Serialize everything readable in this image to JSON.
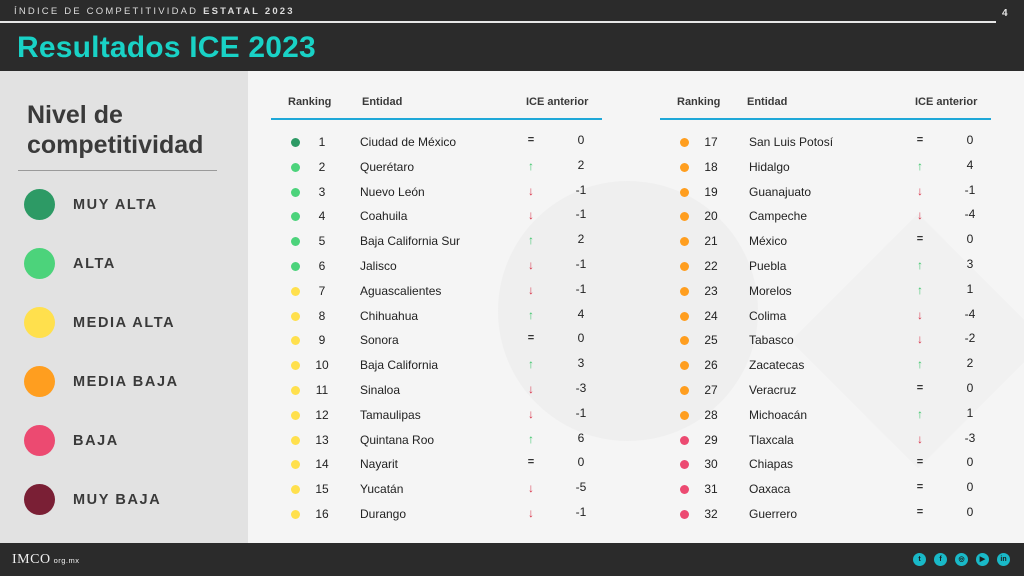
{
  "header": {
    "overline_light": "ÍNDICE DE COMPETITIVIDAD ",
    "overline_bold": "ESTATAL 2023",
    "page_number": "4",
    "title": "Resultados ICE 2023"
  },
  "legend": {
    "title": "Nivel de competitividad",
    "items": [
      {
        "label": "MUY ALTA",
        "color": "#2d9a65"
      },
      {
        "label": "ALTA",
        "color": "#4cd37b"
      },
      {
        "label": "MEDIA ALTA",
        "color": "#ffe04d"
      },
      {
        "label": "MEDIA BAJA",
        "color": "#ff9e1f"
      },
      {
        "label": "BAJA",
        "color": "#ec4a71"
      },
      {
        "label": "MUY BAJA",
        "color": "#7a1f35"
      }
    ]
  },
  "table": {
    "columns": [
      "Ranking",
      "Entidad",
      "ICE anterior"
    ],
    "left_rows": [
      {
        "rank": "1",
        "entity": "Ciudad de México",
        "trend": "=",
        "change": "0",
        "color": "#2d9a65"
      },
      {
        "rank": "2",
        "entity": "Querétaro",
        "trend": "↑",
        "change": "2",
        "color": "#4cd37b"
      },
      {
        "rank": "3",
        "entity": "Nuevo León",
        "trend": "↓",
        "change": "-1",
        "color": "#4cd37b"
      },
      {
        "rank": "4",
        "entity": "Coahuila",
        "trend": "↓",
        "change": "-1",
        "color": "#4cd37b"
      },
      {
        "rank": "5",
        "entity": "Baja California Sur",
        "trend": "↑",
        "change": "2",
        "color": "#4cd37b"
      },
      {
        "rank": "6",
        "entity": "Jalisco",
        "trend": "↓",
        "change": "-1",
        "color": "#4cd37b"
      },
      {
        "rank": "7",
        "entity": "Aguascalientes",
        "trend": "↓",
        "change": "-1",
        "color": "#ffe04d"
      },
      {
        "rank": "8",
        "entity": "Chihuahua",
        "trend": "↑",
        "change": "4",
        "color": "#ffe04d"
      },
      {
        "rank": "9",
        "entity": "Sonora",
        "trend": "=",
        "change": "0",
        "color": "#ffe04d"
      },
      {
        "rank": "10",
        "entity": "Baja California",
        "trend": "↑",
        "change": "3",
        "color": "#ffe04d"
      },
      {
        "rank": "11",
        "entity": "Sinaloa",
        "trend": "↓",
        "change": "-3",
        "color": "#ffe04d"
      },
      {
        "rank": "12",
        "entity": "Tamaulipas",
        "trend": "↓",
        "change": "-1",
        "color": "#ffe04d"
      },
      {
        "rank": "13",
        "entity": "Quintana Roo",
        "trend": "↑",
        "change": "6",
        "color": "#ffe04d"
      },
      {
        "rank": "14",
        "entity": "Nayarit",
        "trend": "=",
        "change": "0",
        "color": "#ffe04d"
      },
      {
        "rank": "15",
        "entity": "Yucatán",
        "trend": "↓",
        "change": "-5",
        "color": "#ffe04d"
      },
      {
        "rank": "16",
        "entity": "Durango",
        "trend": "↓",
        "change": "-1",
        "color": "#ffe04d"
      }
    ],
    "right_rows": [
      {
        "rank": "17",
        "entity": "San Luis Potosí",
        "trend": "=",
        "change": "0",
        "color": "#ff9e1f"
      },
      {
        "rank": "18",
        "entity": "Hidalgo",
        "trend": "↑",
        "change": "4",
        "color": "#ff9e1f"
      },
      {
        "rank": "19",
        "entity": "Guanajuato",
        "trend": "↓",
        "change": "-1",
        "color": "#ff9e1f"
      },
      {
        "rank": "20",
        "entity": "Campeche",
        "trend": "↓",
        "change": "-4",
        "color": "#ff9e1f"
      },
      {
        "rank": "21",
        "entity": "México",
        "trend": "=",
        "change": "0",
        "color": "#ff9e1f"
      },
      {
        "rank": "22",
        "entity": "Puebla",
        "trend": "↑",
        "change": "3",
        "color": "#ff9e1f"
      },
      {
        "rank": "23",
        "entity": "Morelos",
        "trend": "↑",
        "change": "1",
        "color": "#ff9e1f"
      },
      {
        "rank": "24",
        "entity": "Colima",
        "trend": "↓",
        "change": "-4",
        "color": "#ff9e1f"
      },
      {
        "rank": "25",
        "entity": "Tabasco",
        "trend": "↓",
        "change": "-2",
        "color": "#ff9e1f"
      },
      {
        "rank": "26",
        "entity": "Zacatecas",
        "trend": "↑",
        "change": "2",
        "color": "#ff9e1f"
      },
      {
        "rank": "27",
        "entity": "Veracruz",
        "trend": "=",
        "change": "0",
        "color": "#ff9e1f"
      },
      {
        "rank": "28",
        "entity": "Michoacán",
        "trend": "↑",
        "change": "1",
        "color": "#ff9e1f"
      },
      {
        "rank": "29",
        "entity": "Tlaxcala",
        "trend": "↓",
        "change": "-3",
        "color": "#ec4a71"
      },
      {
        "rank": "30",
        "entity": "Chiapas",
        "trend": "=",
        "change": "0",
        "color": "#ec4a71"
      },
      {
        "rank": "31",
        "entity": "Oaxaca",
        "trend": "=",
        "change": "0",
        "color": "#ec4a71"
      },
      {
        "rank": "32",
        "entity": "Guerrero",
        "trend": "=",
        "change": "0",
        "color": "#ec4a71"
      }
    ]
  },
  "footer": {
    "logo_text": "IMCO",
    "logo_domain": "org.mx",
    "social_icons": [
      "twitter-icon",
      "facebook-icon",
      "instagram-icon",
      "youtube-icon",
      "linkedin-icon"
    ],
    "accent_color": "#19b9c8"
  }
}
